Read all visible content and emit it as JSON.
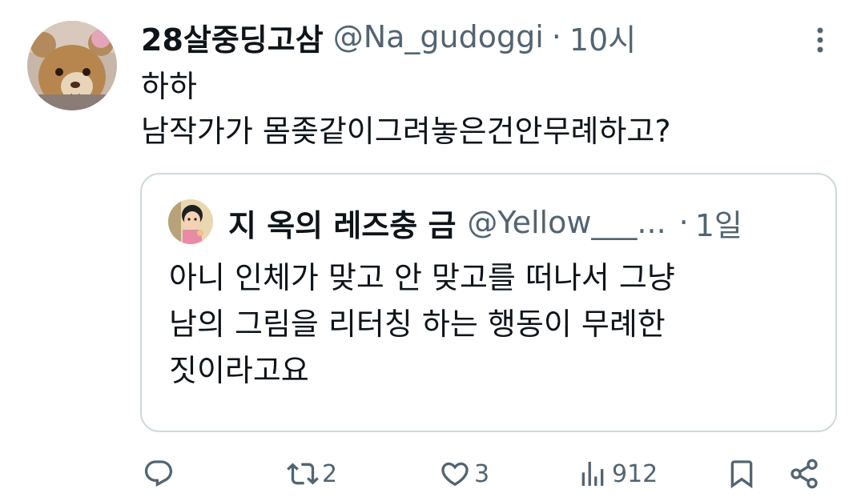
{
  "tweet": {
    "display_name": "28살중딩고삼",
    "handle": "@Na_gudoggi",
    "separator": "·",
    "time": "10시",
    "text_lines": [
      "하하",
      "남작가가 몸좆같이그려놓은건안무례하고?"
    ]
  },
  "quoted_tweet": {
    "display_name": "지 옥의 레즈충 금",
    "handle": "@Yellow___...",
    "separator": "·",
    "time": "1일",
    "text_lines": [
      "아니 인체가 맞고 안 맞고를 떠나서 그냥",
      "남의 그림을 리터칭 하는 행동이 무례한",
      "짓이라고요"
    ]
  },
  "actions": {
    "reply": {
      "icon": "reply-icon",
      "count": ""
    },
    "retweet": {
      "icon": "retweet-icon",
      "count": "2"
    },
    "like": {
      "icon": "heart-icon",
      "count": "3"
    },
    "views": {
      "icon": "views-icon",
      "count": "912"
    },
    "bookmark": {
      "icon": "bookmark-icon"
    },
    "share": {
      "icon": "share-icon"
    }
  },
  "colors": {
    "text": "#0f1419",
    "secondary": "#536471",
    "border": "#cfd9de"
  }
}
